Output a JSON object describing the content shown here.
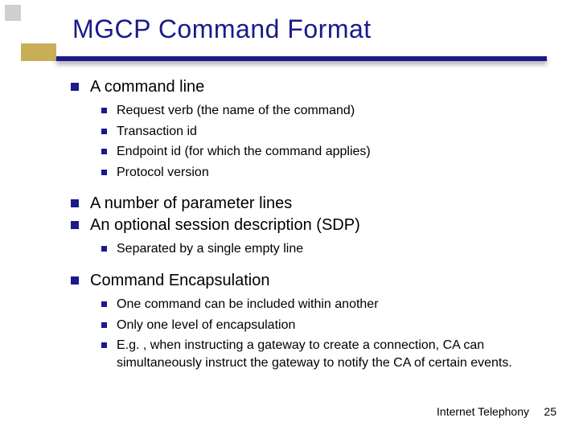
{
  "title": "MGCP Command Format",
  "bullets": [
    {
      "text": "A command line",
      "sub": [
        "Request verb (the name of the command)",
        "Transaction id",
        "Endpoint id (for which the command applies)",
        "Protocol version"
      ]
    },
    {
      "text": "A number of parameter lines",
      "sub": []
    },
    {
      "text": "An optional session description (SDP)",
      "sub": [
        "Separated by a single empty line"
      ]
    },
    {
      "text": "Command Encapsulation",
      "sub": [
        "One command can be included within another",
        "Only one level of encapsulation",
        "E.g. , when instructing a gateway to create a connection, CA can simultaneously instruct the gateway to notify the CA of certain events."
      ]
    }
  ],
  "footer": {
    "label": "Internet Telephony",
    "page": "25"
  }
}
